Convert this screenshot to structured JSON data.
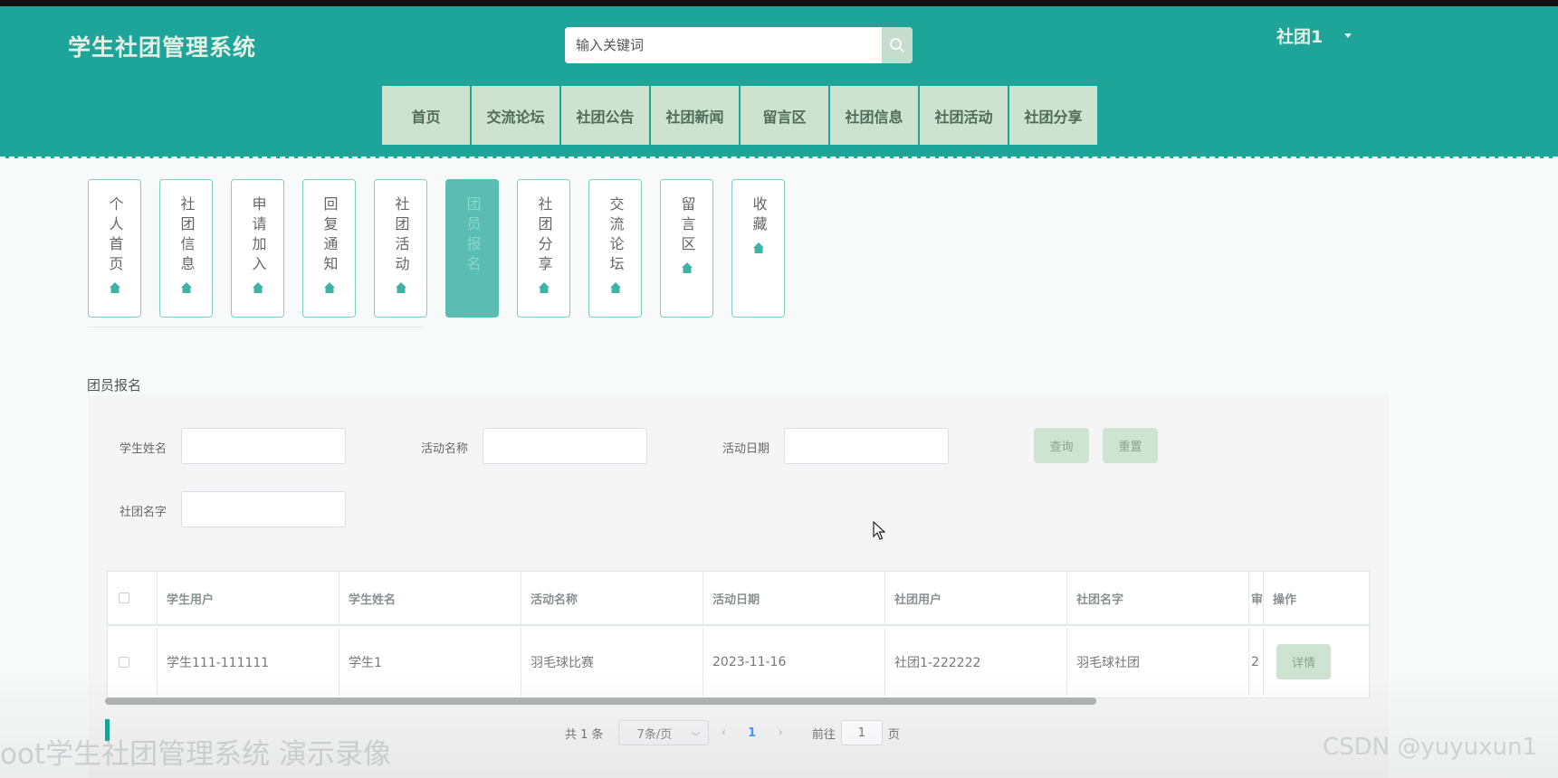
{
  "header": {
    "site_title": "学生社团管理系统",
    "search_placeholder": "输入关键词",
    "user_name": "社团1"
  },
  "nav": [
    "首页",
    "交流论坛",
    "社团公告",
    "社团新闻",
    "留言区",
    "社团信息",
    "社团活动",
    "社团分享"
  ],
  "side_tabs": [
    {
      "label": "个人首页",
      "active": false
    },
    {
      "label": "社团信息",
      "active": false
    },
    {
      "label": "申请加入",
      "active": false
    },
    {
      "label": "回复通知",
      "active": false
    },
    {
      "label": "社团活动",
      "active": false
    },
    {
      "label": "团员报名",
      "active": true
    },
    {
      "label": "社团分享",
      "active": false
    },
    {
      "label": "交流论坛",
      "active": false
    },
    {
      "label": "留言区",
      "active": false
    },
    {
      "label": "收藏",
      "active": false
    }
  ],
  "section_title": "团员报名",
  "filters": {
    "student_name_label": "学生姓名",
    "activity_name_label": "活动名称",
    "activity_date_label": "活动日期",
    "club_name_label": "社团名字",
    "query_button": "查询",
    "reset_button": "重置"
  },
  "table": {
    "columns": [
      "学生用户",
      "学生姓名",
      "活动名称",
      "活动日期",
      "社团用户",
      "社团名字",
      "审",
      "操作"
    ],
    "rows": [
      {
        "student_user": "学生111-111111",
        "student_name": "学生1",
        "activity_name": "羽毛球比赛",
        "activity_date": "2023-11-16",
        "club_user": "社团1-222222",
        "club_name": "羽毛球社团",
        "clipped": "2",
        "action": "详情"
      }
    ]
  },
  "pagination": {
    "total": "共 1 条",
    "page_size": "7条/页",
    "current_page": "1",
    "goto_prefix": "前往",
    "goto_value": "1",
    "goto_suffix": "页"
  },
  "watermarks": {
    "left": "oot学生社团管理系统 演示录像",
    "right": "CSDN @yuyuxun1"
  },
  "colors": {
    "primary": "#1ca598",
    "nav_bg": "#cde3cf",
    "active_tab": "#5bbdb1",
    "link": "#409eff"
  }
}
